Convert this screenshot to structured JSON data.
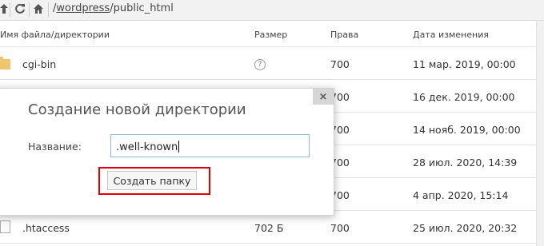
{
  "toolbar": {
    "path_prefix": "/",
    "path_link": "wordpress",
    "path_suffix": "/public_html"
  },
  "table": {
    "headers": {
      "name": "Имя файла/директории",
      "size": "Размер",
      "rights": "Права",
      "date": "Дата изменения"
    },
    "rows": [
      {
        "name": "cgi-bin",
        "size": "?",
        "rights": "700",
        "date": "11 мар. 2019, 00:00",
        "type": "folder"
      },
      {
        "name": "",
        "size": "",
        "rights": "700",
        "date": "16 дек. 2019, 00:00",
        "type": "folder"
      },
      {
        "name": "",
        "size": "",
        "rights": "700",
        "date": "14 нояб. 2019, 00:00",
        "type": "folder"
      },
      {
        "name": "",
        "size": "",
        "rights": "700",
        "date": "28 июл. 2020, 14:39",
        "type": "folder"
      },
      {
        "name": "",
        "size": "",
        "rights": "700",
        "date": "4 апр. 2020, 15:14",
        "type": "folder"
      },
      {
        "name": ".htaccess",
        "size": "702 Б",
        "rights": "700",
        "date": "25 июл. 2020, 20:32",
        "type": "file"
      }
    ]
  },
  "dialog": {
    "title": "Создание новой директории",
    "name_label": "Название:",
    "name_value": ".well-known",
    "create_button": "Создать папку",
    "close": "×"
  }
}
